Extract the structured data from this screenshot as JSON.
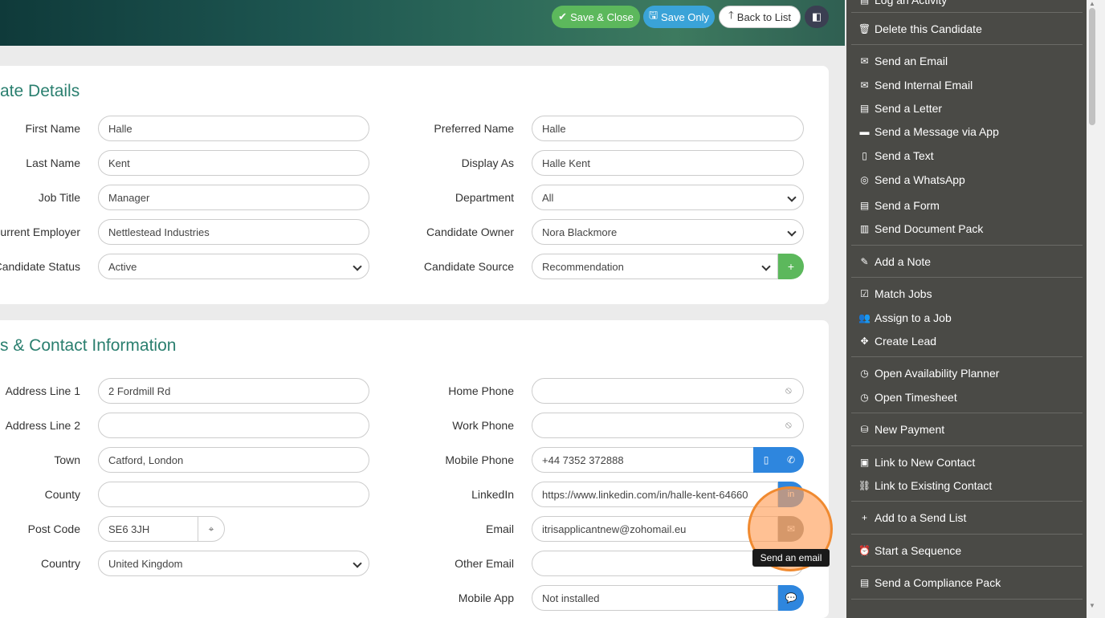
{
  "toolbar": {
    "save_close": "Save & Close",
    "save_only": "Save Only",
    "back_to_list": "Back to List"
  },
  "details": {
    "title": "ate Details",
    "fields": {
      "first_name": {
        "label": "First Name",
        "value": "Halle"
      },
      "last_name": {
        "label": "Last Name",
        "value": "Kent"
      },
      "job_title": {
        "label": "Job Title",
        "value": "Manager"
      },
      "current_employer": {
        "label": "urrent Employer",
        "value": "Nettlestead Industries"
      },
      "candidate_status": {
        "label": "Candidate Status",
        "value": "Active"
      },
      "preferred_name": {
        "label": "Preferred Name",
        "value": "Halle"
      },
      "display_as": {
        "label": "Display As",
        "value": "Halle Kent"
      },
      "department": {
        "label": "Department",
        "value": "All"
      },
      "candidate_owner": {
        "label": "Candidate Owner",
        "value": "Nora Blackmore"
      },
      "candidate_source": {
        "label": "Candidate Source",
        "value": "Recommendation"
      }
    }
  },
  "contact": {
    "title": "s & Contact Information",
    "fields": {
      "address1": {
        "label": "Address Line 1",
        "value": "2 Fordmill Rd"
      },
      "address2": {
        "label": "Address Line 2",
        "value": ""
      },
      "town": {
        "label": "Town",
        "value": "Catford, London"
      },
      "county": {
        "label": "County",
        "value": ""
      },
      "post_code": {
        "label": "Post Code",
        "value": "SE6 3JH"
      },
      "country": {
        "label": "Country",
        "value": "United Kingdom"
      },
      "home_phone": {
        "label": "Home Phone",
        "value": ""
      },
      "work_phone": {
        "label": "Work Phone",
        "value": ""
      },
      "mobile_phone": {
        "label": "Mobile Phone",
        "value": "+44 7352 372888"
      },
      "linkedin": {
        "label": "LinkedIn",
        "value": "https://www.linkedin.com/in/halle-kent-64660"
      },
      "email": {
        "label": "Email",
        "value": "itrisapplicantnew@zohomail.eu"
      },
      "other_email": {
        "label": "Other Email",
        "value": ""
      },
      "mobile_app": {
        "label": "Mobile App",
        "value": "Not installed"
      }
    }
  },
  "tooltip": "Send an email",
  "sidebar": {
    "items": [
      {
        "label": "Log an Activity",
        "icon": "clipboard-icon"
      },
      {
        "label": "Delete this Candidate",
        "icon": "trash-icon"
      },
      {
        "label": "Send an Email",
        "icon": "envelope-icon"
      },
      {
        "label": "Send Internal Email",
        "icon": "envelope-icon"
      },
      {
        "label": "Send a Letter",
        "icon": "document-icon"
      },
      {
        "label": "Send a Message via App",
        "icon": "chat-icon"
      },
      {
        "label": "Send a Text",
        "icon": "mobile-icon"
      },
      {
        "label": "Send a WhatsApp",
        "icon": "whatsapp-icon"
      },
      {
        "label": "Send a Form",
        "icon": "form-icon"
      },
      {
        "label": "Send Document Pack",
        "icon": "documents-icon"
      },
      {
        "label": "Add a Note",
        "icon": "edit-icon"
      },
      {
        "label": "Match Jobs",
        "icon": "checkbox-icon"
      },
      {
        "label": "Assign to a Job",
        "icon": "users-icon"
      },
      {
        "label": "Create Lead",
        "icon": "arrows-icon"
      },
      {
        "label": "Open Availability Planner",
        "icon": "clock-icon"
      },
      {
        "label": "Open Timesheet",
        "icon": "clock-icon"
      },
      {
        "label": "New Payment",
        "icon": "money-icon"
      },
      {
        "label": "Link to New Contact",
        "icon": "contact-card-icon"
      },
      {
        "label": "Link to Existing Contact",
        "icon": "link-icon"
      },
      {
        "label": "Add to a Send List",
        "icon": "plus-icon"
      },
      {
        "label": "Start a Sequence",
        "icon": "alarm-icon"
      },
      {
        "label": "Send a Compliance Pack",
        "icon": "clipboard-icon"
      }
    ]
  }
}
